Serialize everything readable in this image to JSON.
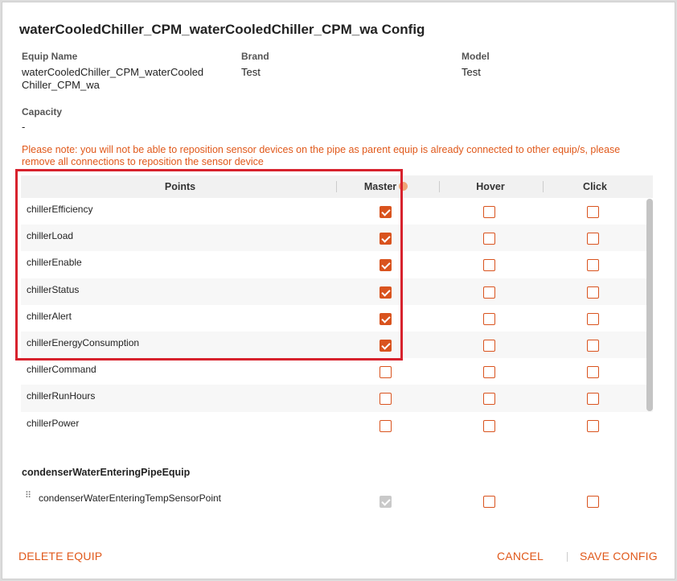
{
  "dialog": {
    "title": "waterCooledChiller_CPM_waterCooledChiller_CPM_wa Config"
  },
  "info": {
    "equip_name_label": "Equip Name",
    "equip_name_line1": "waterCooledChiller_CPM_waterCooled",
    "equip_name_line2": "Chiller_CPM_wa",
    "brand_label": "Brand",
    "brand_value": "Test",
    "model_label": "Model",
    "model_value": "Test",
    "capacity_label": "Capacity",
    "capacity_value": "-"
  },
  "note": {
    "line1": "Please note: you will not be able to reposition sensor devices on the pipe as parent equip is already connected to other equip/s, please",
    "line2": "remove all connections to reposition the sensor device"
  },
  "table": {
    "headers": {
      "points": "Points",
      "master": "Master",
      "hover": "Hover",
      "click": "Click"
    },
    "rows": [
      {
        "name": "chillerEfficiency",
        "master": true,
        "hover": false,
        "click": false
      },
      {
        "name": "chillerLoad",
        "master": true,
        "hover": false,
        "click": false
      },
      {
        "name": "chillerEnable",
        "master": true,
        "hover": false,
        "click": false
      },
      {
        "name": "chillerStatus",
        "master": true,
        "hover": false,
        "click": false
      },
      {
        "name": "chillerAlert",
        "master": true,
        "hover": false,
        "click": false
      },
      {
        "name": "chillerEnergyConsumption",
        "master": true,
        "hover": false,
        "click": false
      },
      {
        "name": "chillerCommand",
        "master": false,
        "hover": false,
        "click": false
      },
      {
        "name": "chillerRunHours",
        "master": false,
        "hover": false,
        "click": false
      },
      {
        "name": "chillerPower",
        "master": false,
        "hover": false,
        "click": false
      }
    ]
  },
  "section": {
    "title": "condenserWaterEnteringPipeEquip",
    "point_name": "condenserWaterEnteringTempSensorPoint",
    "point_master": "disabled-checked",
    "drag_icon": "drag-handle-icon"
  },
  "footer": {
    "delete_label": "DELETE EQUIP",
    "cancel_label": "CANCEL",
    "save_label": "SAVE CONFIG"
  },
  "colors": {
    "accent": "#e0581a",
    "highlight": "#d7222d"
  }
}
